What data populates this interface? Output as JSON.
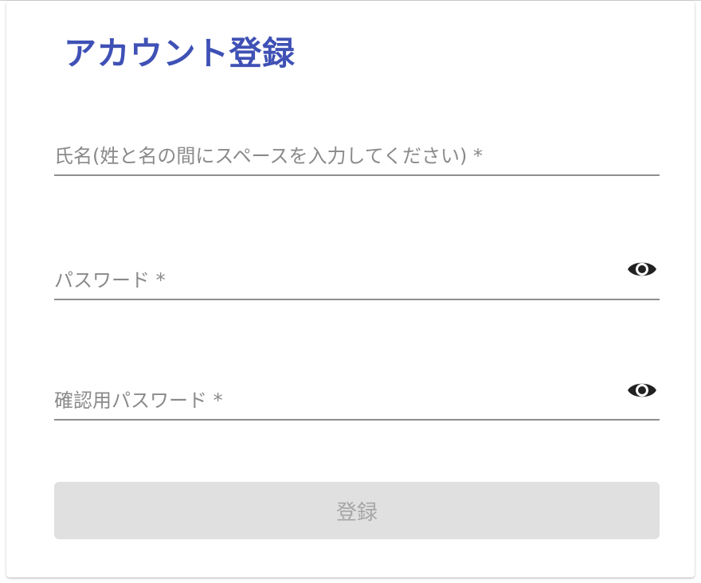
{
  "form": {
    "title": "アカウント登録",
    "fields": [
      {
        "label": "氏名(姓と名の間にスペースを入力してください) *"
      },
      {
        "label": "パスワード *",
        "icon": "eye-icon"
      },
      {
        "label": "確認用パスワード *",
        "icon": "eye-icon"
      }
    ],
    "submit_label": "登録"
  },
  "colors": {
    "title": "#3f51b5",
    "label": "#8a8a8a",
    "underline": "#8e8e8e",
    "button_bg_disabled": "#e0e0e0",
    "button_text_disabled": "#a6a6a6",
    "icon": "#212121"
  }
}
